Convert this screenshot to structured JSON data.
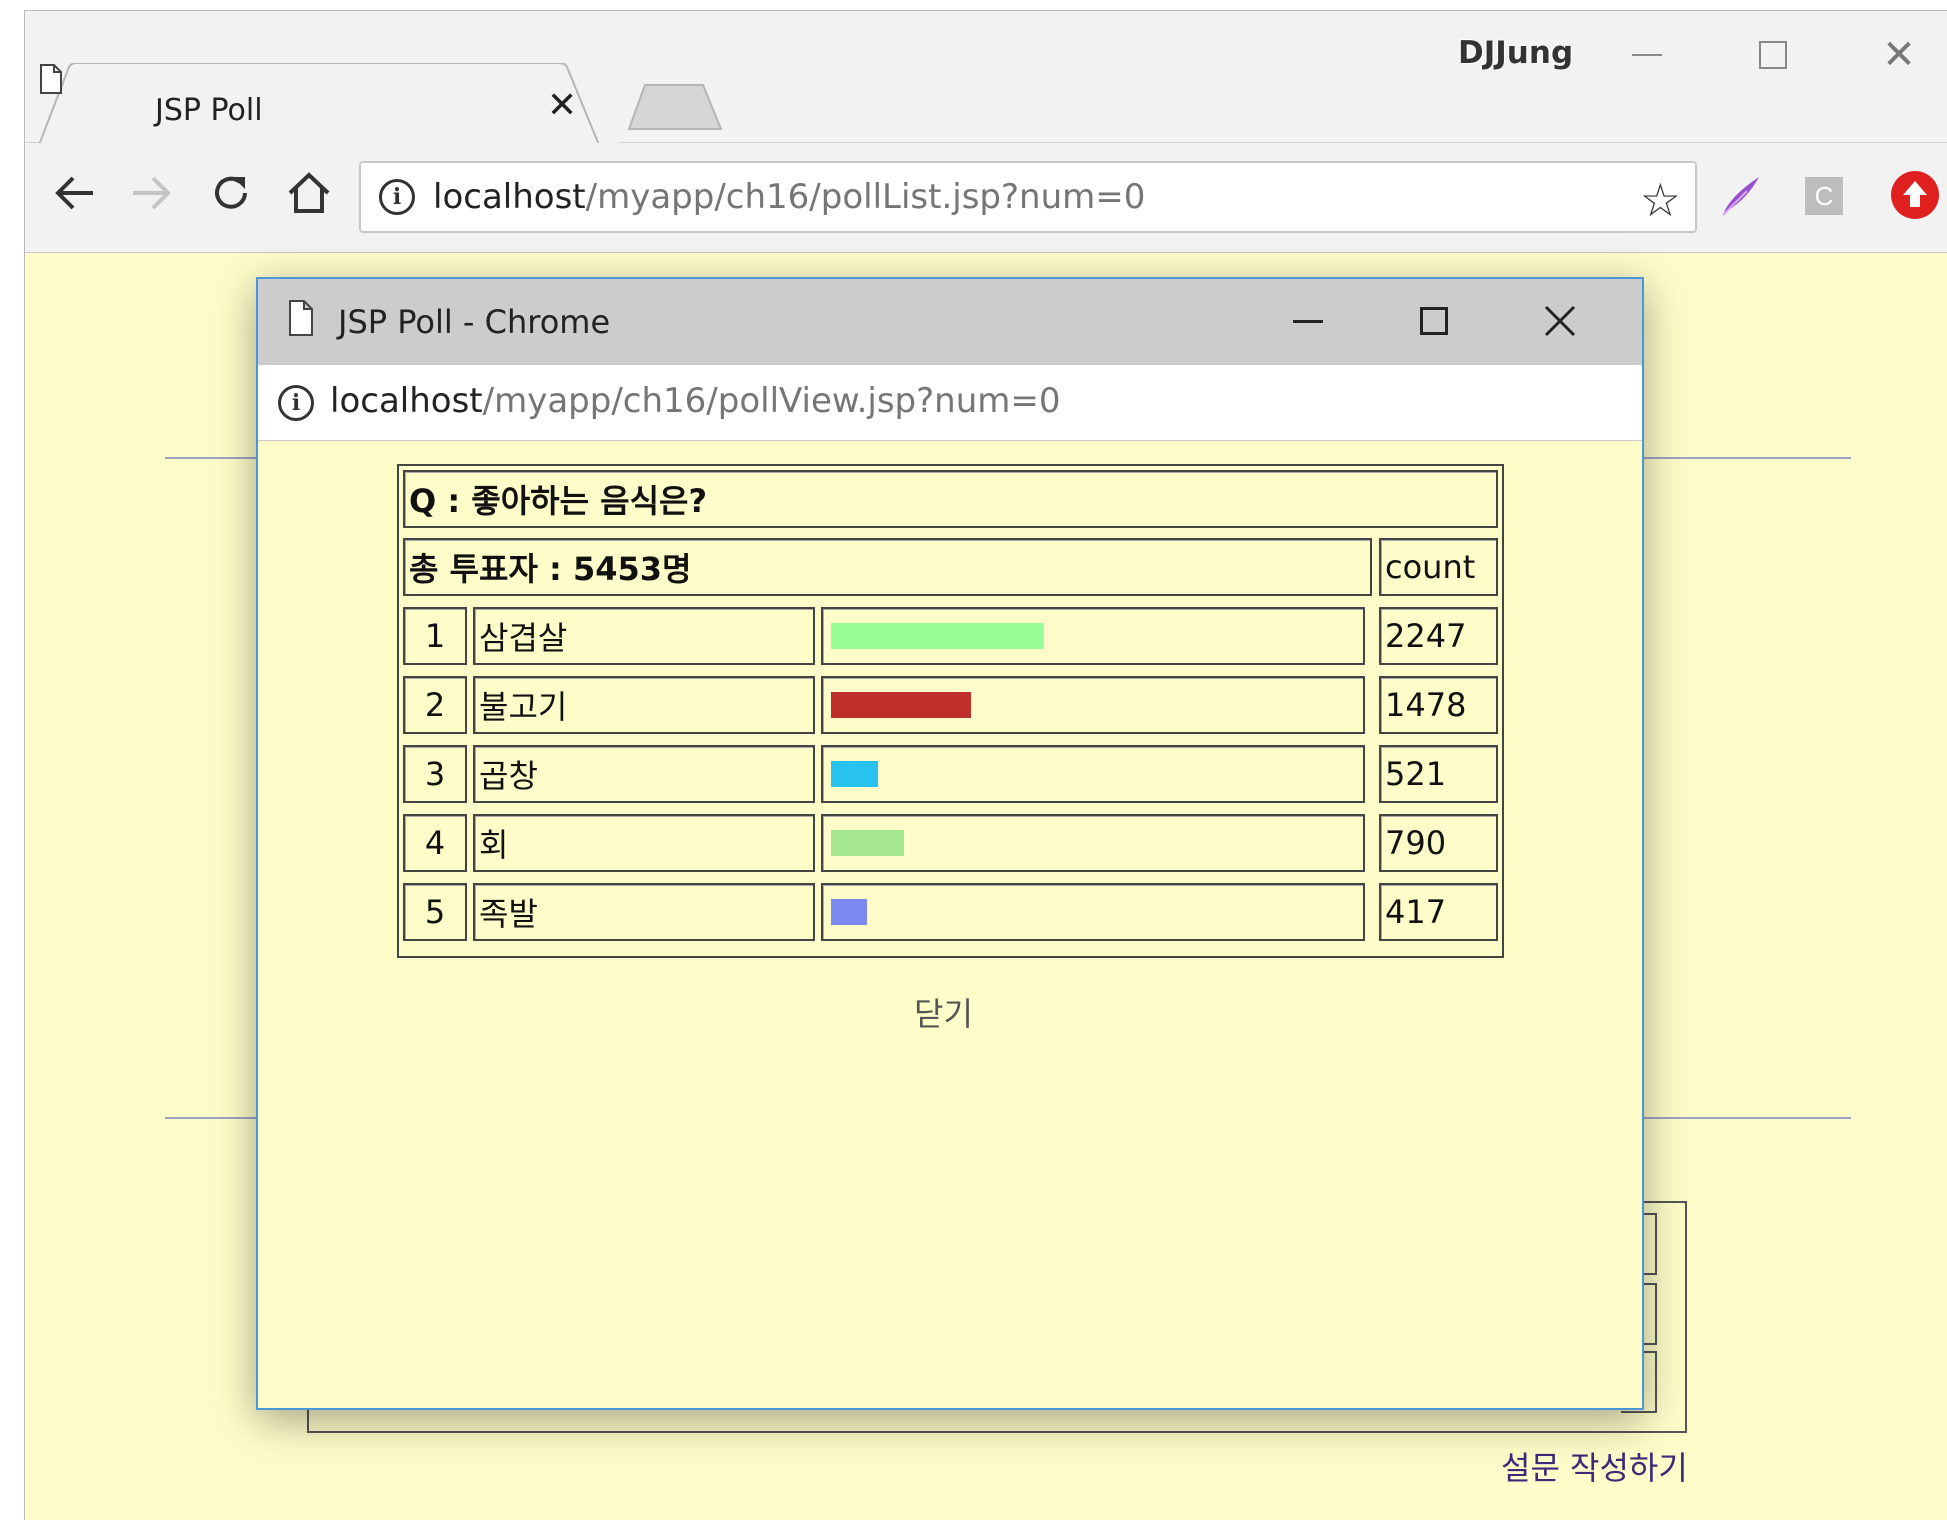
{
  "main_browser": {
    "tab_title": "JSP Poll",
    "user_name": "DJJung",
    "url_host": "localhost",
    "url_path": "/myapp/ch16/pollList.jsp?num=0",
    "extension_c_label": "C"
  },
  "background_page": {
    "create_poll_link": "설문 작성하기"
  },
  "popup": {
    "title": "JSP Poll - Chrome",
    "url_host": "localhost",
    "url_path": "/myapp/ch16/pollView.jsp?num=0"
  },
  "poll": {
    "question": "Q : 좋아하는 음식은?",
    "total_voters": "총 투표자 : 5453명",
    "count_header": "count",
    "items": [
      {
        "num": "1",
        "name": "삼겹살",
        "count": "2247",
        "bar_fraction": 0.41,
        "color": "#98ff98"
      },
      {
        "num": "2",
        "name": "불고기",
        "count": "1478",
        "bar_fraction": 0.27,
        "color": "#c0302a"
      },
      {
        "num": "3",
        "name": "곱창",
        "count": "521",
        "bar_fraction": 0.09,
        "color": "#28c2ee"
      },
      {
        "num": "4",
        "name": "회",
        "count": "790",
        "bar_fraction": 0.14,
        "color": "#a6e890"
      },
      {
        "num": "5",
        "name": "족발",
        "count": "417",
        "bar_fraction": 0.07,
        "color": "#7a88f0"
      }
    ],
    "close_label": "닫기"
  }
}
